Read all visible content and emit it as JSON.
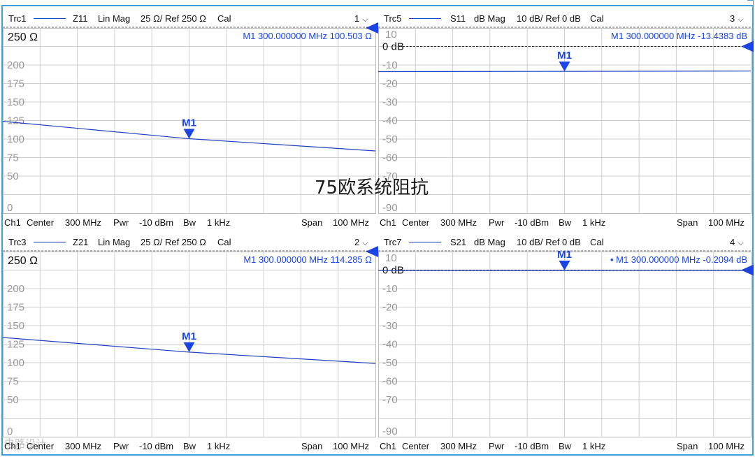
{
  "overlay_text": "75欧系统阻抗",
  "watermark": "电路设计",
  "colors": {
    "trace": "#2040c0",
    "marker": "#1a44e6",
    "grid": "#cfcfcf",
    "frame": "#3fa0e0",
    "tick": "#999999"
  },
  "panels": [
    {
      "trace": "Trc1",
      "param": "Z11",
      "format": "Lin Mag",
      "scale": "25 Ω/ Ref 250 Ω",
      "cal": "Cal",
      "index": "1",
      "ref_label": "250 Ω",
      "marker_readout": "M1  300.000000  MHz  100.503  Ω",
      "marker_label": "M1",
      "y_ticks": [
        "200",
        "175",
        "150",
        "125",
        "100",
        "75",
        "50",
        "0"
      ],
      "footer": {
        "ch": "Ch1",
        "center_label": "Center",
        "center": "300 MHz",
        "pwr_label": "Pwr",
        "pwr": "-10 dBm",
        "bw_label": "Bw",
        "bw": "1 kHz",
        "span_label": "Span",
        "span": "100 MHz"
      },
      "chart_data": {
        "type": "line",
        "x_range_mhz": [
          250,
          350
        ],
        "ylim": [
          0,
          250
        ],
        "series": [
          {
            "x": [
              250,
              300,
              350
            ],
            "y": [
              124,
              100.503,
              84
            ]
          }
        ],
        "marker": {
          "x": 300,
          "y": 100.503
        }
      }
    },
    {
      "trace": "Trc5",
      "param": "S11",
      "format": "dB Mag",
      "scale": "10 dB/ Ref 0 dB",
      "cal": "Cal",
      "index": "3",
      "ref_label": "0 dB",
      "top_label": "10",
      "marker_readout": "M1  300.000000  MHz  -13.4383  dB",
      "marker_label": "M1",
      "y_ticks": [
        "-10",
        "-20",
        "-30",
        "-40",
        "-50",
        "-60",
        "-70",
        "-90"
      ],
      "footer": {
        "ch": "Ch1",
        "center_label": "Center",
        "center": "300 MHz",
        "pwr_label": "Pwr",
        "pwr": "-10 dBm",
        "bw_label": "Bw",
        "bw": "1 kHz",
        "span_label": "Span",
        "span": "100 MHz"
      },
      "chart_data": {
        "type": "line",
        "x_range_mhz": [
          250,
          350
        ],
        "ylim": [
          -90,
          10
        ],
        "series": [
          {
            "x": [
              250,
              300,
              350
            ],
            "y": [
              -13.6,
              -13.4383,
              -13.3
            ]
          }
        ],
        "marker": {
          "x": 300,
          "y": -13.4383
        }
      }
    },
    {
      "trace": "Trc3",
      "param": "Z21",
      "format": "Lin Mag",
      "scale": "25 Ω/ Ref 250 Ω",
      "cal": "Cal",
      "index": "2",
      "ref_label": "250 Ω",
      "marker_readout": "M1  300.000000  MHz  114.285  Ω",
      "marker_label": "M1",
      "y_ticks": [
        "200",
        "175",
        "150",
        "125",
        "100",
        "75",
        "50",
        "0"
      ],
      "footer": {
        "ch": "Ch1",
        "center_label": "Center",
        "center": "300 MHz",
        "pwr_label": "Pwr",
        "pwr": "-10 dBm",
        "bw_label": "Bw",
        "bw": "1 kHz",
        "span_label": "Span",
        "span": "100 MHz"
      },
      "chart_data": {
        "type": "line",
        "x_range_mhz": [
          250,
          350
        ],
        "ylim": [
          0,
          250
        ],
        "series": [
          {
            "x": [
              250,
              300,
              350
            ],
            "y": [
              134,
              114.285,
              99
            ]
          }
        ],
        "marker": {
          "x": 300,
          "y": 114.285
        }
      }
    },
    {
      "trace": "Trc7",
      "param": "S21",
      "format": "dB Mag",
      "scale": "10 dB/ Ref 0 dB",
      "cal": "Cal",
      "index": "4",
      "ref_label": "0 dB",
      "top_label": "10",
      "marker_readout": "• M1  300.000000  MHz  -0.2094  dB",
      "marker_label": "M1",
      "y_ticks": [
        "-10",
        "-20",
        "-30",
        "-40",
        "-50",
        "-60",
        "-70",
        "-90"
      ],
      "footer": {
        "ch": "Ch1",
        "center_label": "Center",
        "center": "300 MHz",
        "pwr_label": "Pwr",
        "pwr": "-10 dBm",
        "bw_label": "Bw",
        "bw": "1 kHz",
        "span_label": "Span",
        "span": "100 MHz"
      },
      "chart_data": {
        "type": "line",
        "x_range_mhz": [
          250,
          350
        ],
        "ylim": [
          -90,
          10
        ],
        "series": [
          {
            "x": [
              250,
              300,
              350
            ],
            "y": [
              -0.25,
              -0.2094,
              -0.18
            ]
          }
        ],
        "marker": {
          "x": 300,
          "y": -0.2094
        }
      }
    }
  ]
}
